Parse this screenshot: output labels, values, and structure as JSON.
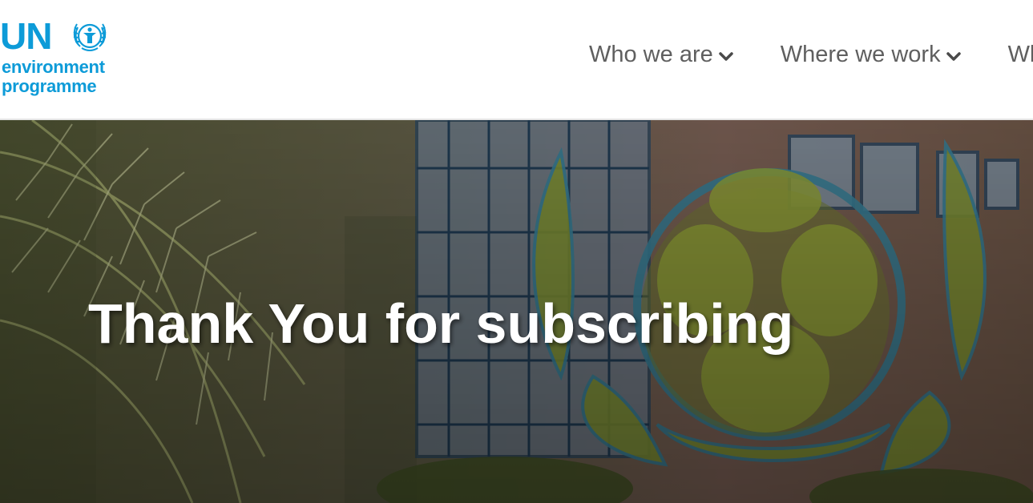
{
  "logo": {
    "short": "UN",
    "line1": "environment",
    "line2": "programme",
    "emblem_icon": "unep-emblem-icon",
    "color": "#0d9bd8"
  },
  "nav": {
    "items": [
      {
        "label": "Who we are",
        "icon": "chevron-down-icon"
      },
      {
        "label": "Where we work",
        "icon": "chevron-down-icon"
      },
      {
        "label": "Wh"
      }
    ]
  },
  "hero": {
    "title": "Thank You for subscribing",
    "image": "photo of UNEP emblem sculpture covered in plants with palm leaves and office building"
  },
  "colors": {
    "brand": "#0d9bd8",
    "nav_text": "#5f5f5f",
    "hero_text": "#ffffff"
  }
}
